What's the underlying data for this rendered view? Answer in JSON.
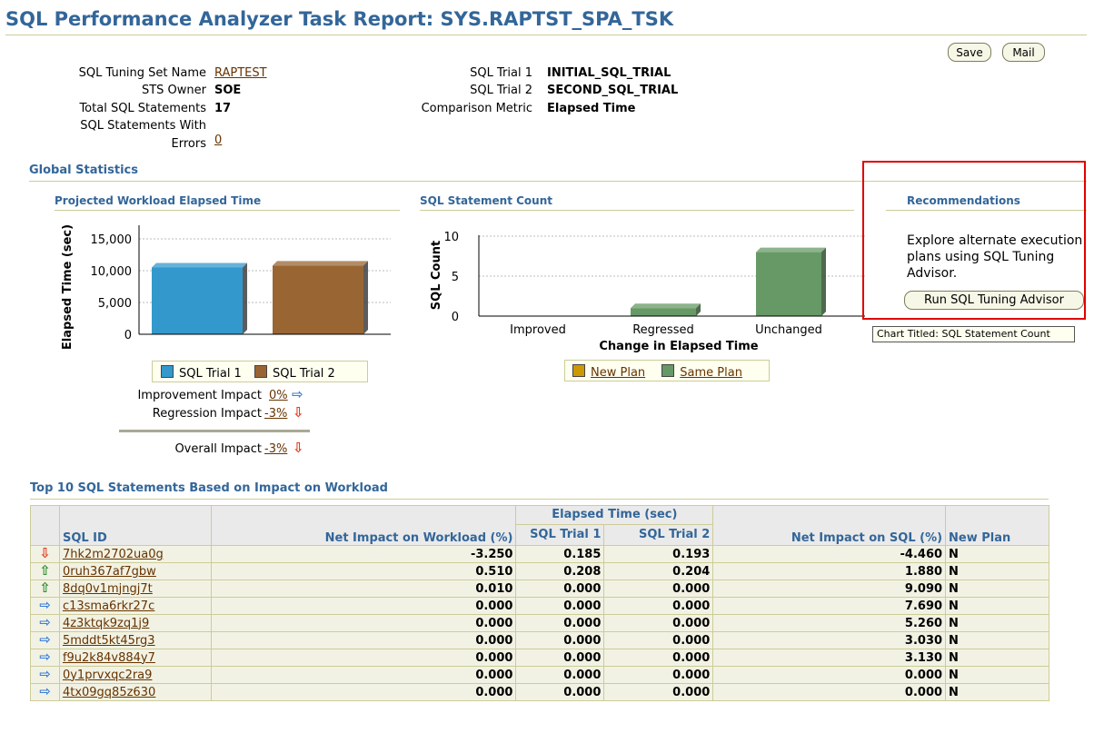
{
  "title": "SQL Performance Analyzer Task Report: SYS.RAPTST_SPA_TSK",
  "actions": {
    "save": "Save",
    "mail": "Mail"
  },
  "summary": {
    "sts_name_label": "SQL Tuning Set Name",
    "sts_name_value": "RAPTEST",
    "sts_owner_label": "STS Owner",
    "sts_owner_value": "SOE",
    "total_label": "Total SQL Statements",
    "total_value": "17",
    "errors_label_1": "SQL Statements With",
    "errors_label_2": "Errors",
    "errors_value": "0",
    "trial1_label": "SQL Trial 1",
    "trial1_value": "INITIAL_SQL_TRIAL",
    "trial2_label": "SQL Trial 2",
    "trial2_value": "SECOND_SQL_TRIAL",
    "metric_label": "Comparison Metric",
    "metric_value": "Elapsed Time"
  },
  "global_stats": {
    "heading": "Global Statistics",
    "projected_heading": "Projected Workload Elapsed Time",
    "count_heading": "SQL Statement Count",
    "recommendations_heading": "Recommendations",
    "recommendation_text": "Explore alternate execution plans using SQL Tuning Advisor.",
    "run_advisor_button": "Run SQL Tuning Advisor",
    "tooltip": "Chart Titled: SQL Statement Count",
    "improvement_label": "Improvement Impact",
    "improvement_value": "0%",
    "regression_label": "Regression Impact",
    "regression_value": "-3%",
    "overall_label": "Overall Impact",
    "overall_value": "-3%",
    "highlight_color": "#e00000"
  },
  "chart_data": [
    {
      "type": "bar",
      "categories": [
        ""
      ],
      "series": [
        {
          "name": "SQL Trial 1",
          "values": [
            10500
          ],
          "color": "#3399cc"
        },
        {
          "name": "SQL Trial 2",
          "values": [
            10800
          ],
          "color": "#996633"
        }
      ],
      "ylabel": "Elapsed Time (sec)",
      "ylim": [
        0,
        15000
      ],
      "yticks": [
        "15,000",
        "10,000",
        "5,000",
        "0"
      ],
      "grid": true,
      "legend": "bottom"
    },
    {
      "type": "bar",
      "categories": [
        "Improved",
        "Regressed",
        "Unchanged"
      ],
      "series": [
        {
          "name": "New Plan",
          "values": [
            0,
            0,
            0
          ],
          "color": "#cc9900"
        },
        {
          "name": "Same Plan",
          "values": [
            0,
            1,
            8
          ],
          "color": "#669966"
        }
      ],
      "xlabel": "Change in Elapsed Time",
      "ylabel": "SQL Count",
      "ylim": [
        0,
        10
      ],
      "yticks": [
        "10",
        "5",
        "0"
      ],
      "grid": true,
      "legend": "bottom"
    }
  ],
  "top10": {
    "heading": "Top 10 SQL Statements Based on Impact on Workload",
    "group_header": "Elapsed Time (sec)",
    "columns": [
      "SQL ID",
      "Net Impact on Workload (%)",
      "SQL Trial 1",
      "SQL Trial 2",
      "Net Impact on SQL (%)",
      "New Plan"
    ],
    "rows": [
      {
        "dir": "down",
        "id": "7hk2m2702ua0g",
        "workload": "-3.250",
        "t1": "0.185",
        "t2": "0.193",
        "sql": "-4.460",
        "plan": "N"
      },
      {
        "dir": "up",
        "id": "0ruh367af7gbw",
        "workload": "0.510",
        "t1": "0.208",
        "t2": "0.204",
        "sql": "1.880",
        "plan": "N"
      },
      {
        "dir": "up",
        "id": "8dq0v1mjngj7t",
        "workload": "0.010",
        "t1": "0.000",
        "t2": "0.000",
        "sql": "9.090",
        "plan": "N"
      },
      {
        "dir": "right",
        "id": "c13sma6rkr27c",
        "workload": "0.000",
        "t1": "0.000",
        "t2": "0.000",
        "sql": "7.690",
        "plan": "N"
      },
      {
        "dir": "right",
        "id": "4z3ktqk9zq1j9",
        "workload": "0.000",
        "t1": "0.000",
        "t2": "0.000",
        "sql": "5.260",
        "plan": "N"
      },
      {
        "dir": "right",
        "id": "5mddt5kt45rg3",
        "workload": "0.000",
        "t1": "0.000",
        "t2": "0.000",
        "sql": "3.030",
        "plan": "N"
      },
      {
        "dir": "right",
        "id": "f9u2k84v884y7",
        "workload": "0.000",
        "t1": "0.000",
        "t2": "0.000",
        "sql": "3.130",
        "plan": "N"
      },
      {
        "dir": "right",
        "id": "0y1prvxqc2ra9",
        "workload": "0.000",
        "t1": "0.000",
        "t2": "0.000",
        "sql": "0.000",
        "plan": "N"
      },
      {
        "dir": "right",
        "id": "4tx09gq85z630",
        "workload": "0.000",
        "t1": "0.000",
        "t2": "0.000",
        "sql": "0.000",
        "plan": "N"
      }
    ]
  }
}
